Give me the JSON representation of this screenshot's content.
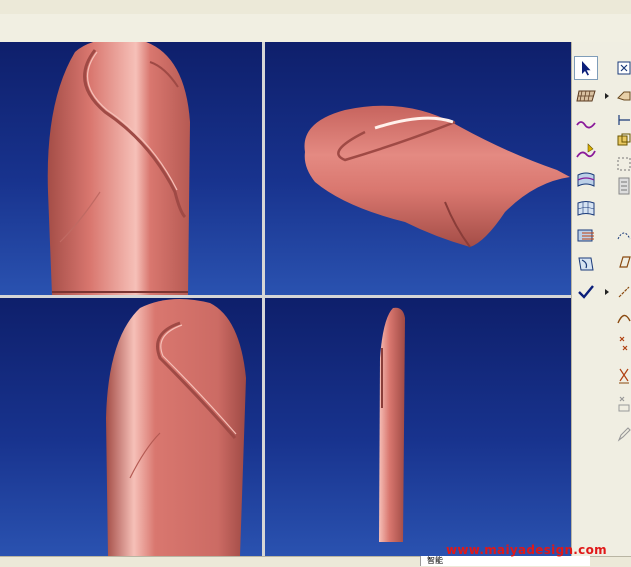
{
  "watermark": "www.maiyadesign.com",
  "status": {
    "field_text": "智能"
  },
  "side_toolbar": [
    {
      "name": "select-arrow-icon",
      "selected": true,
      "arrow": false
    },
    {
      "name": "plane-grid-icon",
      "selected": false,
      "arrow": true
    },
    {
      "name": "curve-wave-icon",
      "selected": false,
      "arrow": false
    },
    {
      "name": "sketch-curve-icon",
      "selected": false,
      "arrow": false
    },
    {
      "name": "boundary-surface-icon",
      "selected": false,
      "arrow": false
    },
    {
      "name": "surface-mesh-icon",
      "selected": false,
      "arrow": false
    },
    {
      "name": "surface-edit-icon",
      "selected": false,
      "arrow": false
    },
    {
      "name": "surface-trim-icon",
      "selected": false,
      "arrow": false
    },
    {
      "name": "checkmark-icon",
      "selected": false,
      "arrow": true
    }
  ],
  "colors": {
    "model": "#d9776f",
    "model_highlight": "#f6c0b8",
    "model_shadow": "#9f4a45",
    "viewport_top": "#0e1f6b",
    "viewport_bottom": "#2a52b0"
  }
}
